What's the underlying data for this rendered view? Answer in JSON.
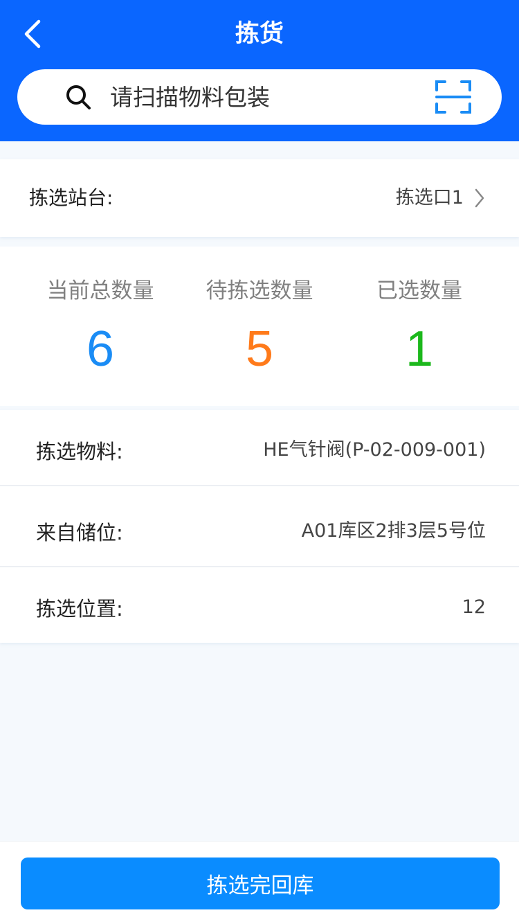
{
  "header": {
    "title": "拣货",
    "back_icon": "chevron-left-icon"
  },
  "search": {
    "placeholder": "请扫描物料包装",
    "search_icon": "search-icon",
    "scan_icon": "scan-icon"
  },
  "station": {
    "label": "拣选站台:",
    "value": "拣选口1",
    "chevron_icon": "chevron-right-icon"
  },
  "stats": [
    {
      "label": "当前总数量",
      "value": "6",
      "color": "#1a8cf5"
    },
    {
      "label": "待拣选数量",
      "value": "5",
      "color": "#ff7a1a"
    },
    {
      "label": "已选数量",
      "value": "1",
      "color": "#1cb81c"
    }
  ],
  "details": [
    {
      "label": "拣选物料:",
      "value": "HE气针阀(P-02-009-001)"
    },
    {
      "label": "来自储位:",
      "value": "A01库区2排3层5号位"
    },
    {
      "label": "拣选位置:",
      "value": "12"
    }
  ],
  "footer": {
    "button_label": "拣选完回库"
  },
  "colors": {
    "header_bg": "#0a66ff",
    "button_bg": "#0a8cff",
    "scan_icon": "#1a8cf5"
  }
}
